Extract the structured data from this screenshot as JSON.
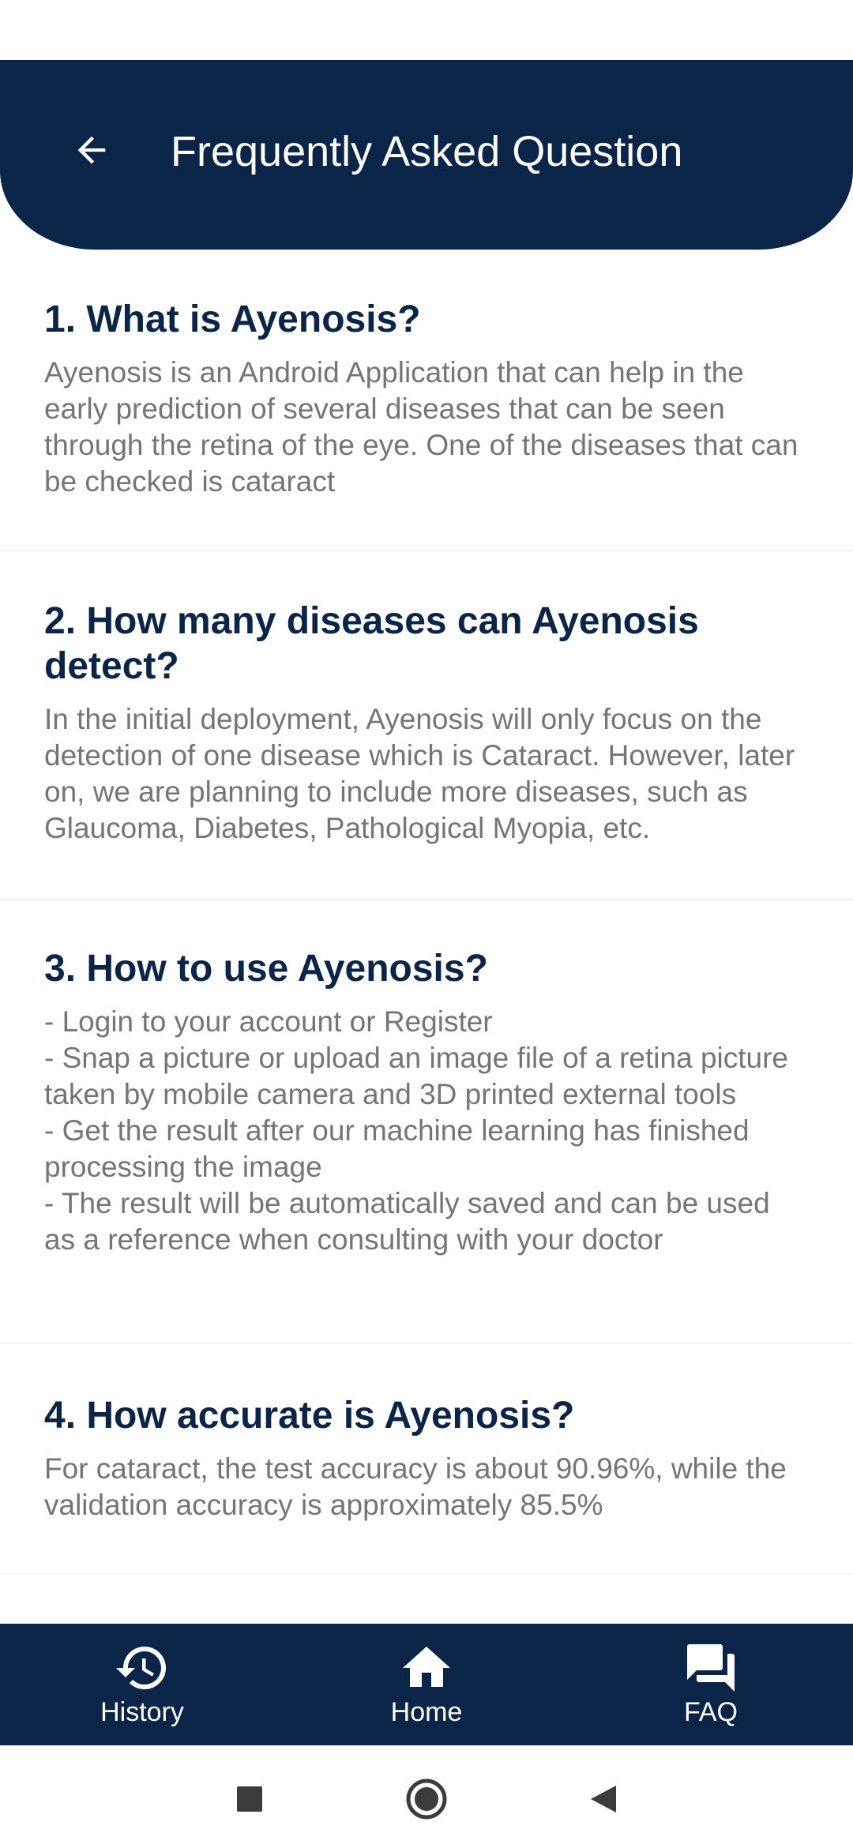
{
  "header": {
    "title": "Frequently Asked Question"
  },
  "faq": [
    {
      "question": "1. What is Ayenosis?",
      "answer": "Ayenosis is an Android Application that can help in the early prediction of several diseases that can be seen through the retina of the eye. One of the diseases that can be checked is cataract"
    },
    {
      "question": "2. How many diseases can Ayenosis detect?",
      "answer": "In the initial deployment, Ayenosis will only focus on the detection of one disease which is Cataract. However, later on, we are planning to include more diseases, such as Glaucoma, Diabetes, Pathological Myopia, etc."
    },
    {
      "question": "3. How to use Ayenosis?",
      "answer": "- Login to your account or Register\n - Snap a picture or upload an image file of a retina picture taken by mobile camera and 3D printed external tools\n - Get the result after our machine learning has finished processing the image\n - The result will be automatically saved and can be used as a reference when consulting with your doctor"
    },
    {
      "question": "4. How accurate is Ayenosis?",
      "answer": "For cataract, the test accuracy is about 90.96%, while the validation accuracy is approximately 85.5%"
    }
  ],
  "bottom_nav": {
    "items": [
      {
        "label": "History",
        "icon": "history-icon"
      },
      {
        "label": "Home",
        "icon": "home-icon"
      },
      {
        "label": "FAQ",
        "icon": "forum-icon"
      }
    ]
  },
  "colors": {
    "primary": "#0a2548",
    "answer_text": "#757575",
    "background": "#ffffff"
  }
}
